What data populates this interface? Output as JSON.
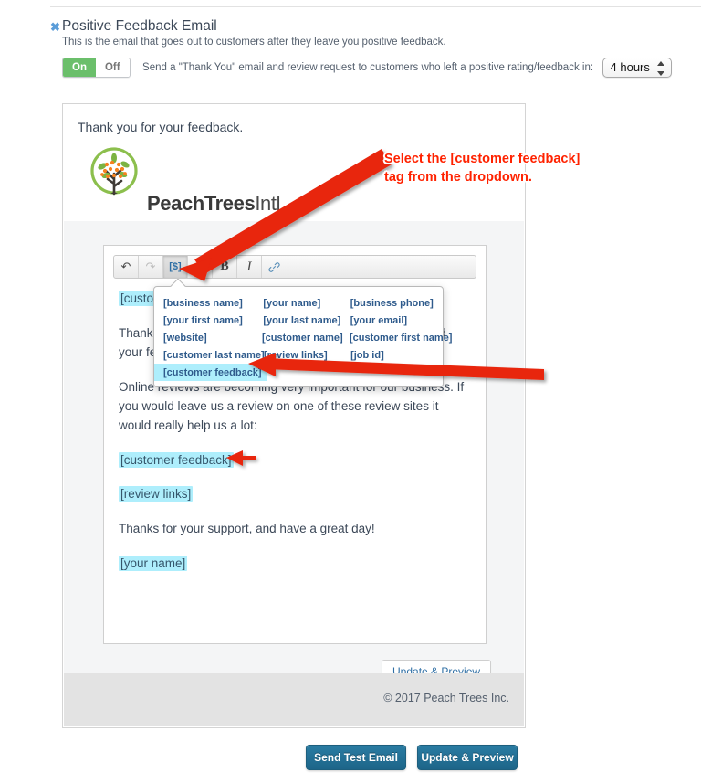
{
  "header": {
    "close_icon": "close-icon",
    "title": "Positive Feedback Email",
    "subtitle": "This is the email that goes out to customers after they leave you positive feedback."
  },
  "toggle": {
    "on_label": "On",
    "off_label": "Off",
    "state": "On",
    "description": "Send a \"Thank You\" email and review request to customers who left a positive rating/feedback in:",
    "delay_value": "4 hours"
  },
  "preview": {
    "subject": "Thank you for your feedback.",
    "logo_name_bold": "PeachTrees",
    "logo_name_light": "Intl.",
    "update_preview_label": "Update & Preview",
    "copyright": "© 2017 Peach Trees Inc."
  },
  "toolbar": {
    "undo": "↶",
    "redo": "↷",
    "tag": "[$]",
    "image": "✉",
    "bold": "B",
    "italic": "I",
    "link": "🔗"
  },
  "email_body": {
    "greeting_tag": "[customer name]",
    "paragraph_1": "Thank you for taking the time to leave us your customer and your feedback.",
    "paragraph_2": "Online reviews are becoming very important for our business. If you would leave us a review on one of these review sites it would really help us a lot:",
    "feedback_tag": "[customer feedback]",
    "review_links_tag": "[review links]",
    "closing": "Thanks for your support, and have a great day!",
    "signature_tag": "[your name]"
  },
  "dropdown": {
    "rows": [
      [
        "[business name]",
        "[your name]",
        "[business phone]"
      ],
      [
        "[your first name]",
        "[your last name]",
        "[your email]"
      ],
      [
        "[website]",
        "[customer name]",
        "[customer first name]"
      ],
      [
        "[customer last name]",
        "[review links]",
        "[job id]"
      ]
    ],
    "selected": "[customer feedback]"
  },
  "annotation": {
    "line1": "Select the [customer feedback]",
    "line2": "tag from the dropdown.",
    "color": "#ff2200"
  },
  "actions": {
    "send_test_label": "Send Test Email",
    "update_preview_label": "Update & Preview"
  },
  "colors": {
    "toggle_on": "#6bbf6b",
    "tag_highlight": "#aeeefc",
    "link_blue": "#2f5b8c",
    "primary_button": "#1d6589",
    "annotation_red": "#ff2200"
  }
}
